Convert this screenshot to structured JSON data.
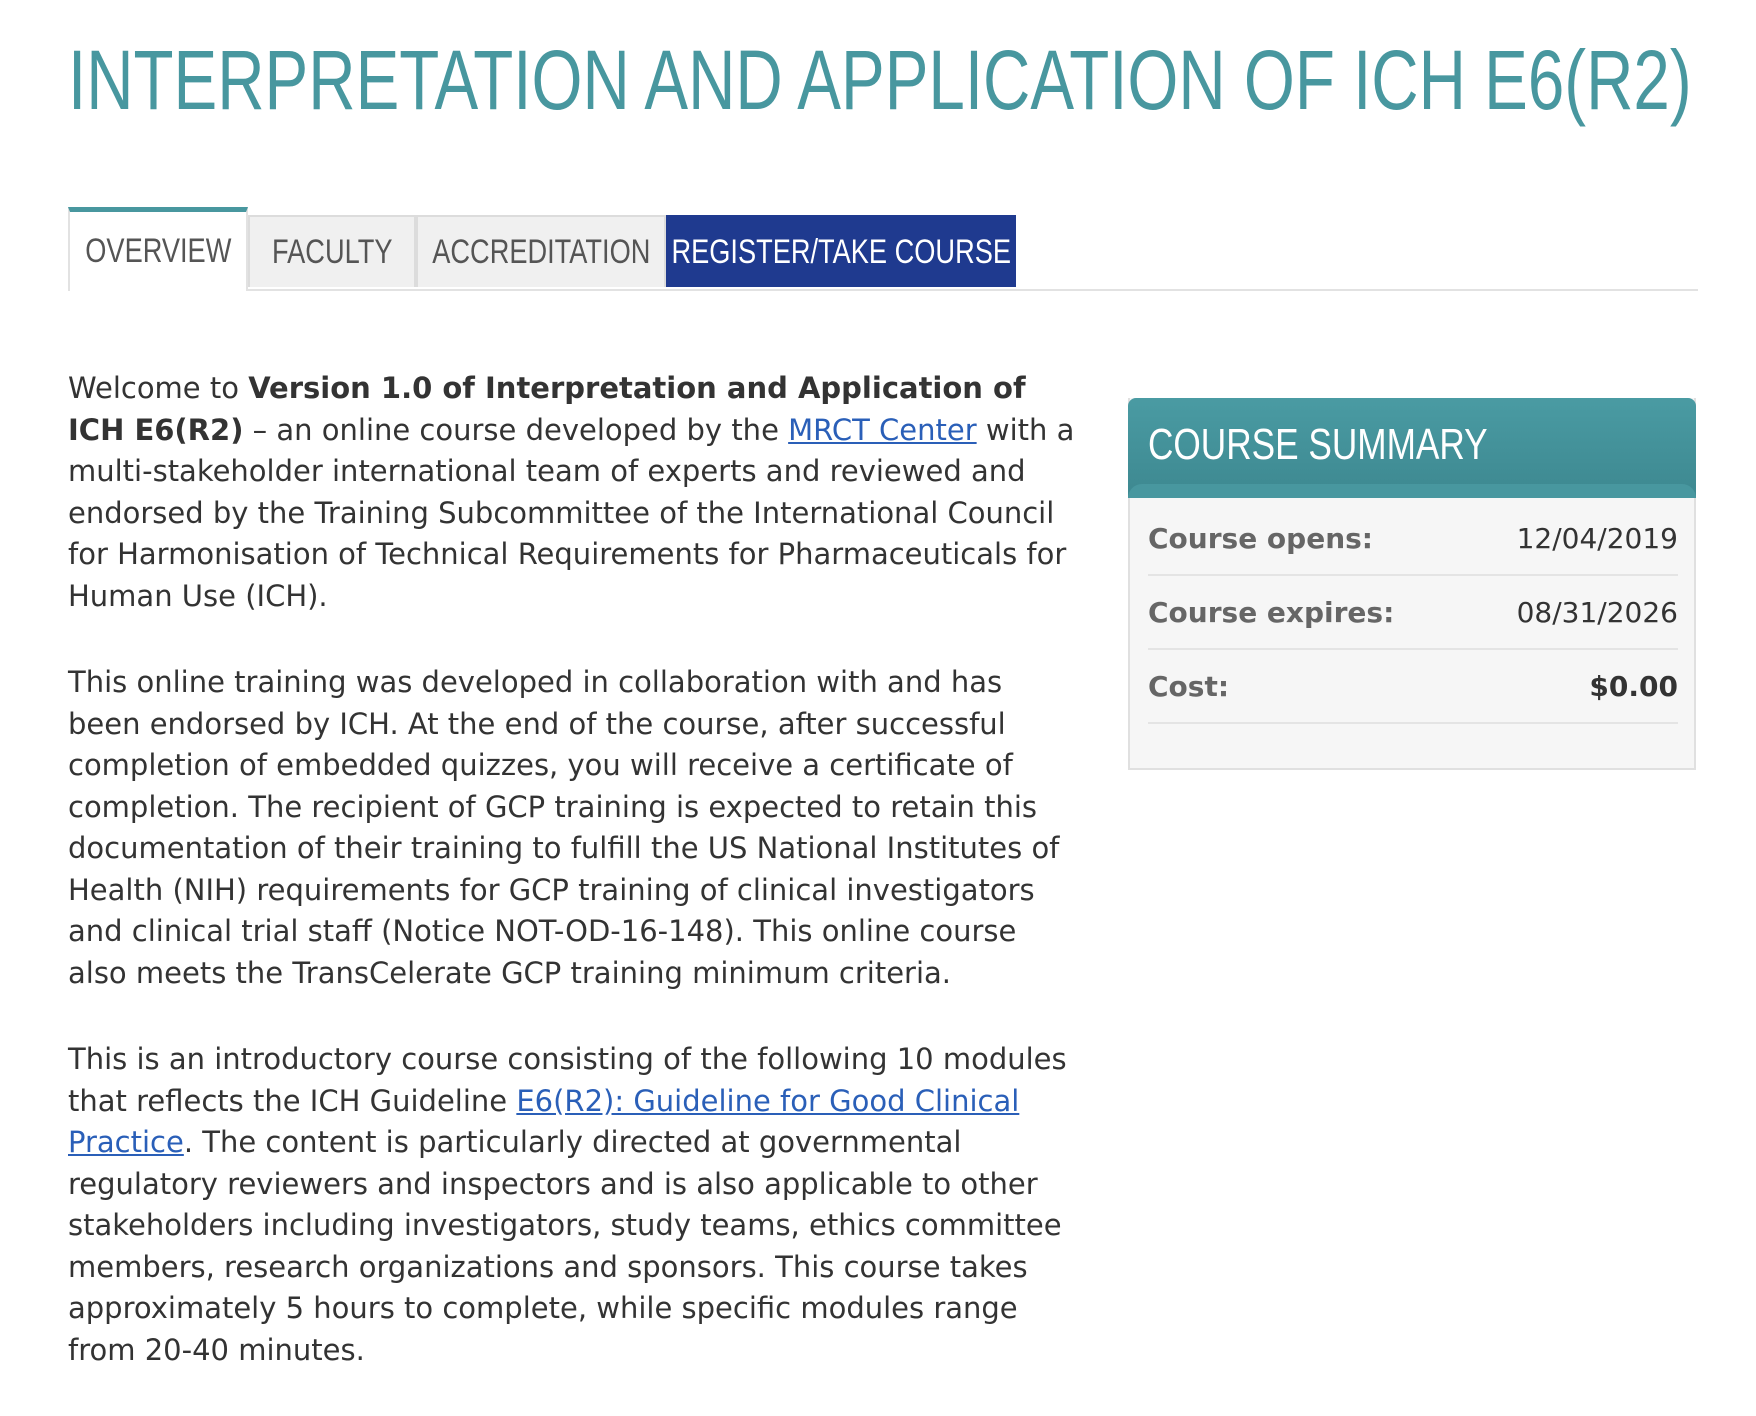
{
  "page": {
    "title": "INTERPRETATION AND APPLICATION OF ICH E6(R2)"
  },
  "tabs": [
    {
      "label": "OVERVIEW",
      "active": true
    },
    {
      "label": "FACULTY",
      "active": false
    },
    {
      "label": "ACCREDITATION",
      "active": false
    },
    {
      "label": "REGISTER/TAKE COURSE",
      "active": false
    }
  ],
  "content": {
    "p1": {
      "intro": "Welcome to ",
      "bold": "Version 1.0 of Interpretation and Application of ICH E6(R2)",
      "mid": " – an online course developed by the ",
      "link": "MRCT Center",
      "end": " with a multi-stakeholder international team of experts and reviewed and endorsed by the Training Subcommittee of the International Council for Harmonisation of Technical Requirements for Pharmaceuticals for Human Use (ICH)."
    },
    "p2": "This online training was developed in collaboration with and has been endorsed by ICH. At the end of the course, after successful completion of embedded quizzes, you will receive a certificate of completion. The recipient of GCP training is expected to retain this documentation of their training to fulfill the US National Institutes of Health (NIH) requirements for GCP training of clinical investigators and clinical trial staff (Notice NOT-OD-16-148). This online course also meets the TransCelerate GCP training minimum criteria.",
    "p3": {
      "start": "This is an introductory course consisting of the following 10 modules that reflects the ICH Guideline  ",
      "link": "E6(R2): Guideline for Good Clinical Practice",
      "end": ". The content is particularly directed at governmental regulatory reviewers and inspectors and is also applicable to other stakeholders including investigators, study teams, ethics committee members, research organizations and sponsors. This course takes approximately 5 hours to complete, while specific modules range from 20-40 minutes."
    }
  },
  "summary": {
    "title": "COURSE SUMMARY",
    "rows": [
      {
        "label": "Course opens:",
        "value": "12/04/2019"
      },
      {
        "label": "Course expires:",
        "value": "08/31/2026"
      },
      {
        "label": "Cost:",
        "value": "$0.00"
      }
    ]
  },
  "colors": {
    "accent": "#48979f",
    "register_tab": "#1f3a8f",
    "link": "#2a5fb8"
  }
}
